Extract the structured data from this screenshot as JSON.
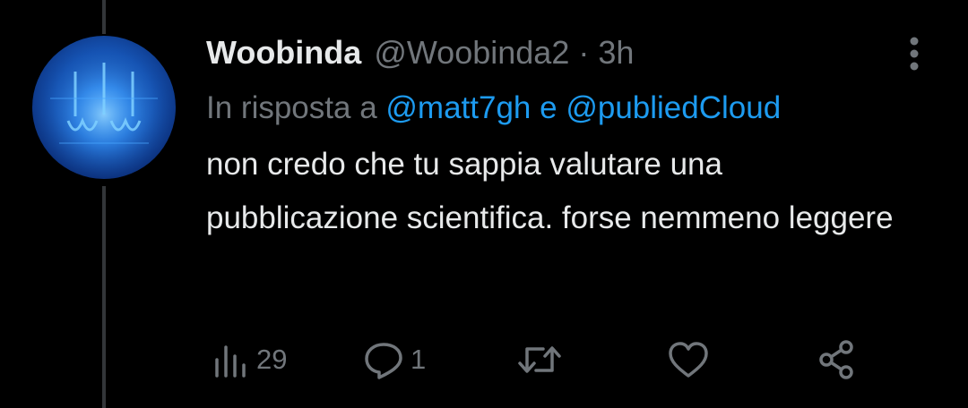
{
  "tweet": {
    "display_name": "Woobinda",
    "handle": "@Woobinda2",
    "separator": "·",
    "time": "3h",
    "reply_prefix": "In risposta a",
    "reply_mention_1": "@matt7gh",
    "reply_conjunction": "e",
    "reply_mention_2": "@publiedCloud",
    "text": "non credo che tu sappia valutare una pubblicazione scientifica. forse nemmeno leggere"
  },
  "actions": {
    "views_count": "29",
    "replies_count": "1",
    "views_icon": "views-icon",
    "reply_icon": "reply-icon",
    "retweet_icon": "retweet-icon",
    "like_icon": "heart-icon",
    "share_icon": "share-icon"
  },
  "colors": {
    "background": "#000000",
    "primary_text": "#e7e9ea",
    "secondary_text": "#71767b",
    "link": "#1d9bf0",
    "avatar_tint": "#1656b8"
  }
}
